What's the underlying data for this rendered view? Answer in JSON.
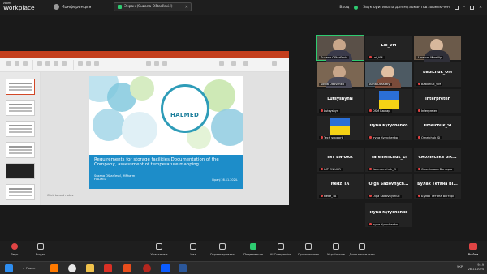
{
  "app": {
    "logo_small": "zoom",
    "logo_big": "Workplace"
  },
  "header": {
    "conference_label": "Конференция",
    "view_tab_label": "Экран (Suzana Oštarčević)",
    "signin_label": "Вход",
    "original_sound_label": "Звук оригинала для музыкантов: выключен"
  },
  "slide": {
    "logo_text": "HALMED",
    "headline": "Requirements for storage facilities,Documentation of the Company, assessment of temperature mapping",
    "authors_line1": "Suzana Oštarčević, MPharm",
    "authors_line2": "HALMED",
    "date": "Lipanj 28.11.2024.",
    "notes_placeholder": "Click to add notes"
  },
  "participants": [
    {
      "name": "Suzana Oštarčević",
      "type": "video"
    },
    {
      "name": "Loi_VM",
      "big": "Loi_VM",
      "type": "name"
    },
    {
      "name": "Lorenzo Morsiliy",
      "type": "video"
    },
    {
      "name": "Sofiia Udovenko",
      "type": "video"
    },
    {
      "name": "Alina Dossatiy",
      "type": "video"
    },
    {
      "name": "Babichuk_OM",
      "big": "Babichuk_OM",
      "type": "name"
    },
    {
      "name": "Lutsyshyn",
      "big": "LutsyshynN",
      "type": "name"
    },
    {
      "name": "DSM Бюлар",
      "type": "flag"
    },
    {
      "name": "Interpreter",
      "big": "Interpreter",
      "type": "name"
    },
    {
      "name": "Tech support",
      "type": "flag"
    },
    {
      "name": "Iryna Kyrychenko",
      "big": "Iryna Kyrychenko",
      "type": "name"
    },
    {
      "name": "Omelchuk_SI",
      "big": "Omelchuk_SI",
      "type": "name"
    },
    {
      "name": "INT EN-UKR",
      "big": "INT EN-UKR",
      "type": "name"
    },
    {
      "name": "Yaremenchuk_El",
      "big": "Yaremenchuk_El",
      "type": "name"
    },
    {
      "name": "Смолінська Вікторія",
      "big": "Смолінська Вік...",
      "type": "name"
    },
    {
      "name": "Hedz_TA",
      "big": "Hedz_TA",
      "type": "name"
    },
    {
      "name": "Olga Sadovnychuk",
      "big": "Olga Sadovnych...",
      "type": "name"
    },
    {
      "name": "Булах Тетяна Вікторі",
      "big": "Булах Тетяна Ві...",
      "type": "name"
    },
    {
      "name": "Iryna Kyrychenko",
      "big": "Iryna Kyrychenko",
      "type": "name"
    }
  ],
  "toolbar": {
    "audio": "Звук",
    "video": "Видео",
    "participants": "Участники",
    "chat": "Чат",
    "react": "Отреагировать",
    "share": "Поделиться",
    "ai": "AI Companion",
    "apps": "Приложения",
    "lang": "Українська",
    "more": "Дополнительно",
    "leave": "Выйти",
    "participants_count": "19"
  },
  "taskbar": {
    "search_label": "Поиск",
    "lang": "УКР",
    "time": "9:19",
    "date": "28.11.2024"
  }
}
